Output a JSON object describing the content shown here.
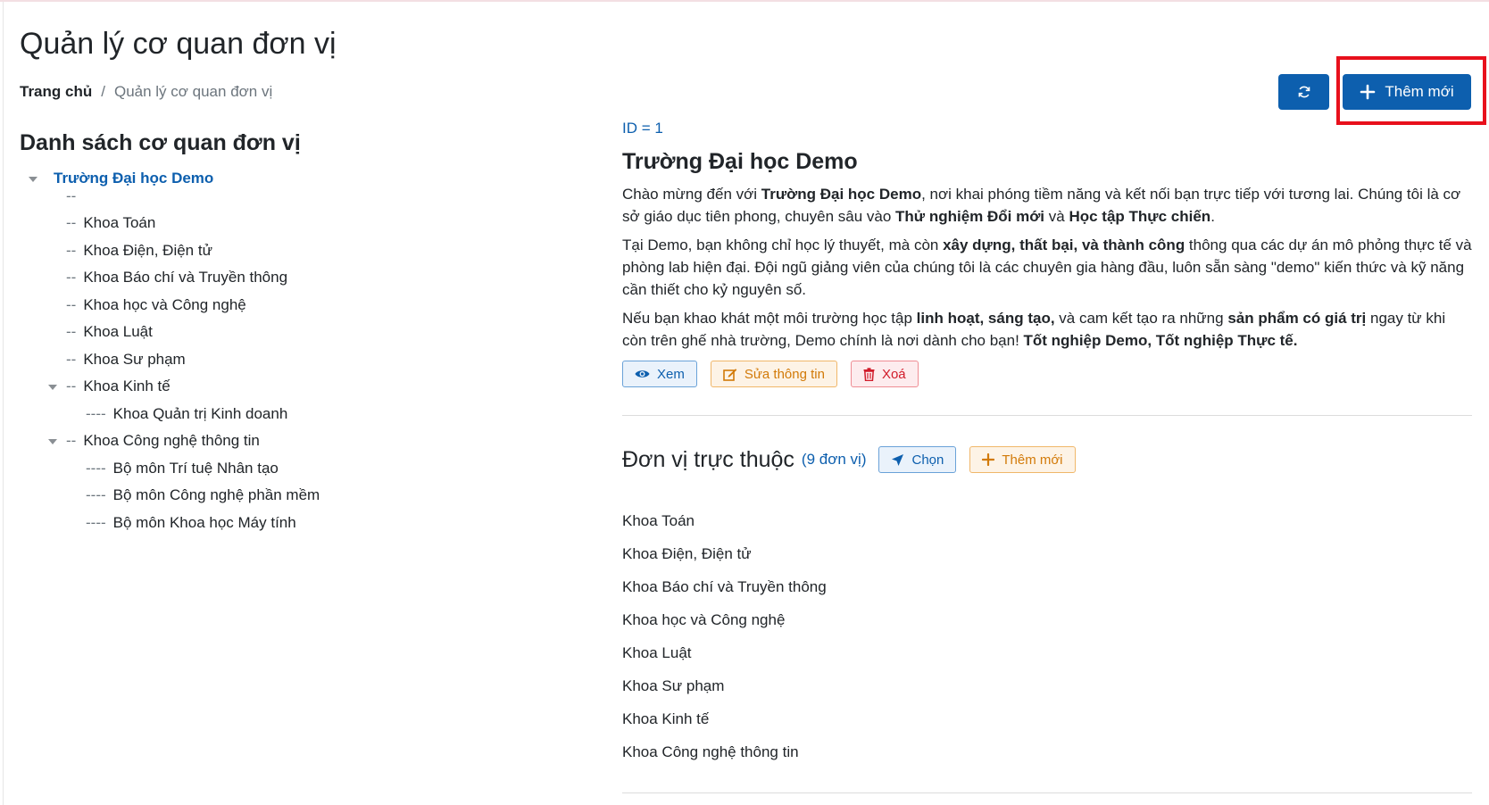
{
  "page": {
    "title": "Quản lý cơ quan đơn vị"
  },
  "breadcrumb": {
    "home": "Trang chủ",
    "separator": "/",
    "current": "Quản lý cơ quan đơn vị"
  },
  "toolbar": {
    "refresh_icon": "refresh-icon",
    "add_label": "Thêm mới",
    "add_icon": "plus-icon"
  },
  "tree": {
    "title": "Danh sách cơ quan đơn vị",
    "root": "Trường Đại học Demo",
    "items": [
      {
        "prefix": "--",
        "label": ""
      },
      {
        "prefix": "--",
        "label": "Khoa Toán"
      },
      {
        "prefix": "--",
        "label": "Khoa Điện, Điện tử"
      },
      {
        "prefix": "--",
        "label": "Khoa Báo chí và Truyền thông"
      },
      {
        "prefix": "--",
        "label": "Khoa học và Công nghệ"
      },
      {
        "prefix": "--",
        "label": "Khoa Luật"
      },
      {
        "prefix": "--",
        "label": "Khoa Sư phạm"
      },
      {
        "prefix": "--",
        "label": "Khoa Kinh tế"
      },
      {
        "prefix": "----",
        "label": "Khoa Quản trị Kinh doanh"
      },
      {
        "prefix": "--",
        "label": "Khoa Công nghệ thông tin"
      },
      {
        "prefix": "----",
        "label": "Bộ môn Trí tuệ Nhân tạo"
      },
      {
        "prefix": "----",
        "label": "Bộ môn Công nghệ phần mềm"
      },
      {
        "prefix": "----",
        "label": "Bộ môn Khoa học Máy tính"
      }
    ]
  },
  "detail": {
    "id_label": "ID = 1",
    "name": "Trường Đại học Demo",
    "p1": {
      "t1": "Chào mừng đến với ",
      "b1": "Trường Đại học Demo",
      "t2": ", nơi khai phóng tiềm năng và kết nối bạn trực tiếp với tương lai. Chúng tôi là cơ sở giáo dục tiên phong, chuyên sâu vào ",
      "b2": "Thử nghiệm Đổi mới",
      "t3": " và ",
      "b3": "Học tập Thực chiến",
      "t4": "."
    },
    "p2": {
      "t1": "Tại Demo, bạn không chỉ học lý thuyết, mà còn ",
      "b1": "xây dựng, thất bại, và thành công",
      "t2": " thông qua các dự án mô phỏng thực tế và phòng lab hiện đại. Đội ngũ giảng viên của chúng tôi là các chuyên gia hàng đầu, luôn sẵn sàng \"demo\" kiến thức và kỹ năng cần thiết cho kỷ nguyên số."
    },
    "p3": {
      "t1": "Nếu bạn khao khát một môi trường học tập ",
      "b1": "linh hoạt, sáng tạo,",
      "t2": " và cam kết tạo ra những ",
      "b2": "sản phẩm có giá trị",
      "t3": " ngay từ khi còn trên ghế nhà trường, Demo chính là nơi dành cho bạn! ",
      "b3": "Tốt nghiệp Demo, Tốt nghiệp Thực tế."
    },
    "actions": {
      "view": "Xem",
      "edit": "Sửa thông tin",
      "delete": "Xoá"
    }
  },
  "subunits": {
    "title": "Đơn vị trực thuộc",
    "count": "(9 đơn vị)",
    "choose": "Chọn",
    "add": "Thêm mới",
    "items": [
      "Khoa Toán",
      "Khoa Điện, Điện tử",
      "Khoa Báo chí và Truyền thông",
      "Khoa học và Công nghệ",
      "Khoa Luật",
      "Khoa Sư phạm",
      "Khoa Kinh tế",
      "Khoa Công nghệ thông tin"
    ]
  },
  "colors": {
    "primary": "#0d5fae",
    "warning": "#d27a08",
    "danger": "#d11b2a",
    "highlight": "#e8101c"
  }
}
